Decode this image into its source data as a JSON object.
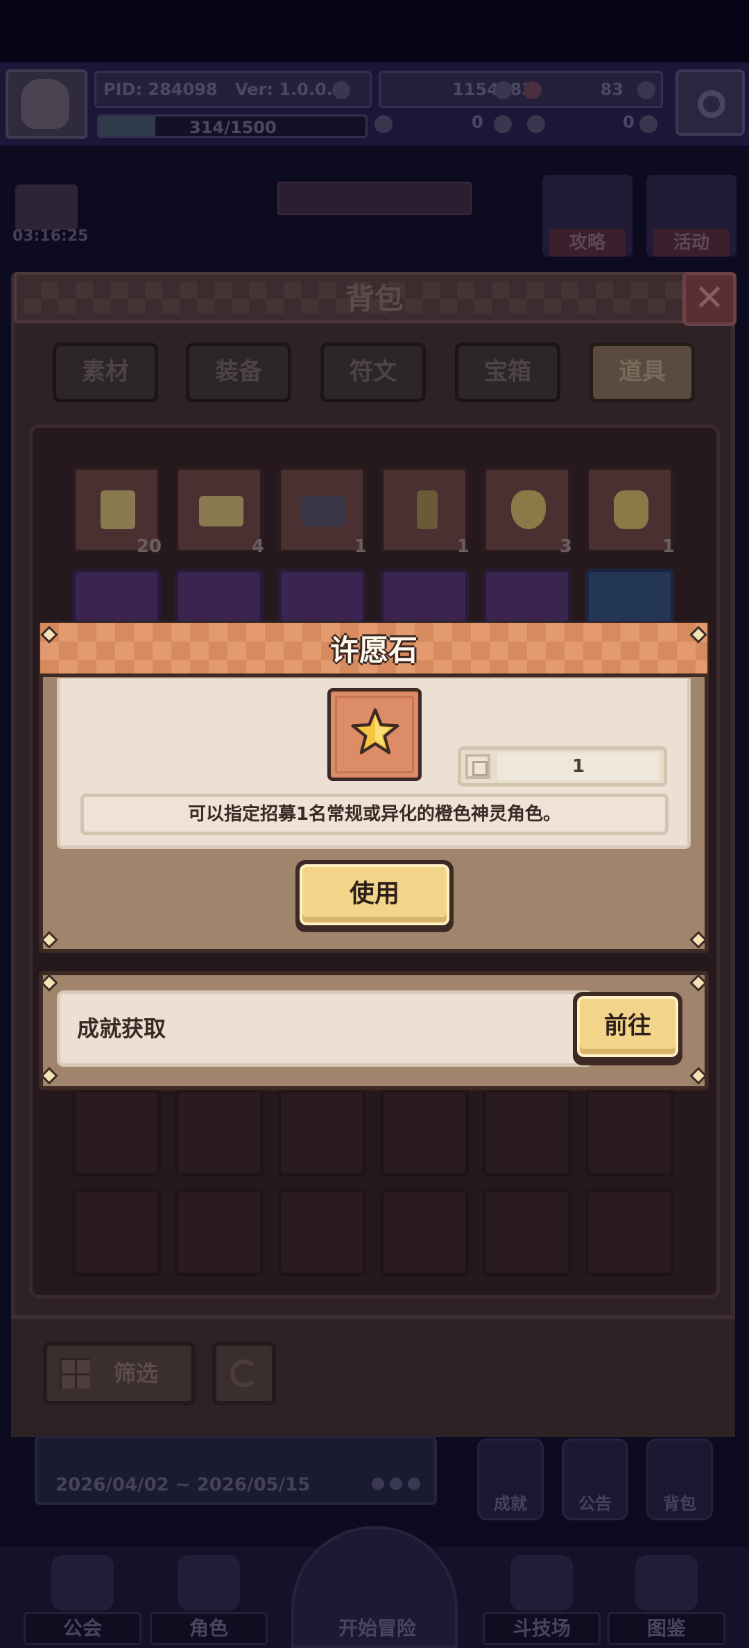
{
  "hud": {
    "pid": "PID: 284098",
    "version": "Ver: 1.0.0.8",
    "gold": "1154183",
    "gems": "83",
    "stamina": "314/1500",
    "stamina_progress": 0.21,
    "resource_a": "0",
    "resource_b": "0",
    "timer": "03:16:25",
    "guide_label": "攻略",
    "event_label": "活动"
  },
  "bag": {
    "title": "背包",
    "close_glyph": "✕",
    "tabs": [
      "素材",
      "装备",
      "符文",
      "宝箱",
      "道具"
    ],
    "active_tab": 4,
    "row1_counts": [
      "20",
      "4",
      "1",
      "1",
      "3",
      "1"
    ],
    "filter_label": "筛选"
  },
  "item_popup": {
    "title": "许愿石",
    "quantity": "1",
    "description": "可以指定招募1名常规或异化的橙色神灵角色。",
    "use_label": "使用"
  },
  "source_popup": {
    "source_label": "成就获取",
    "goto_label": "前往"
  },
  "bottom": {
    "date_range": "2026/04/02 ~ 2026/05/15",
    "mini_buttons": [
      "成就",
      "公告",
      "背包"
    ],
    "nav": [
      "公会",
      "角色",
      "开始冒险",
      "斗技场",
      "图鉴"
    ]
  },
  "colors": {
    "popup_title_bar": "#d68a5e",
    "button_yellow": "#f3d58a",
    "popup_body": "#ebe0d3",
    "frame_dark": "#3e2a25"
  }
}
